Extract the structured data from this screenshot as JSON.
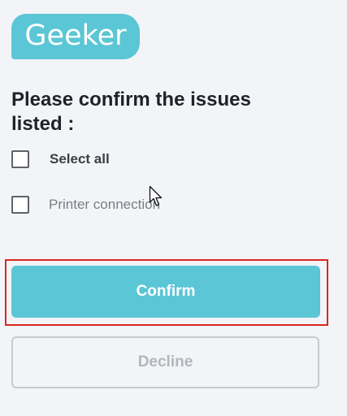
{
  "brand": {
    "logo_text": "Geeker"
  },
  "heading": "Please confirm the issues listed :",
  "checklist": {
    "items": [
      {
        "label": "Select all",
        "checked": false
      },
      {
        "label": "Printer connection",
        "checked": false
      }
    ]
  },
  "actions": {
    "confirm_label": "Confirm",
    "decline_label": "Decline"
  },
  "colors": {
    "accent": "#5bc6d5",
    "highlight_outline": "#d8281e",
    "background": "#f3f4f8"
  }
}
